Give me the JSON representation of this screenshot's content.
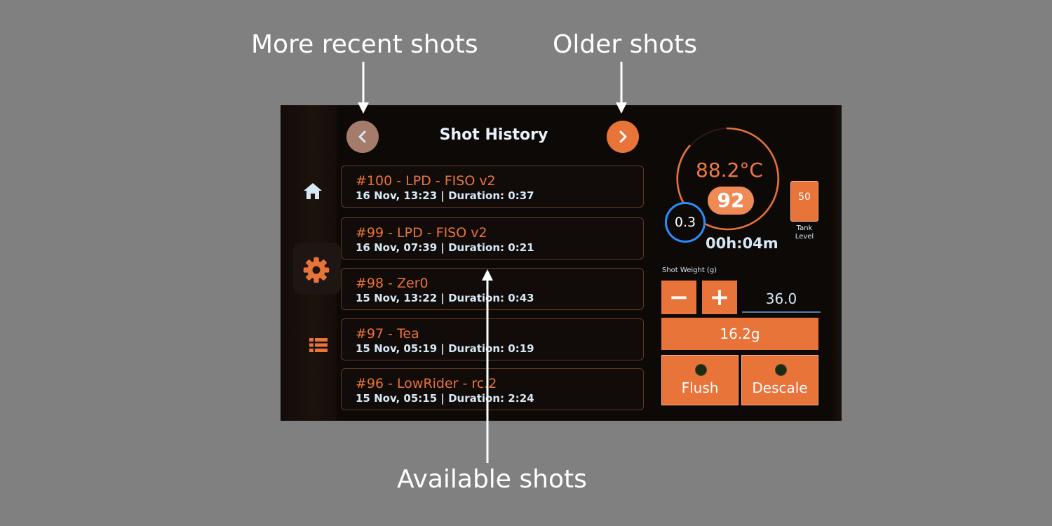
{
  "annotations": {
    "more_recent": "More recent shots",
    "older": "Older shots",
    "available": "Available shots"
  },
  "header": {
    "title": "Shot History"
  },
  "icons": {
    "prev": "chevron-left-icon",
    "next": "chevron-right-icon",
    "home": "home-icon",
    "settings": "gear-icon",
    "list": "list-icon"
  },
  "shots": [
    {
      "title": "#100 - LPD - FISO v2",
      "meta": "16 Nov, 13:23 | Duration: 0:37"
    },
    {
      "title": "#99 - LPD - FISO v2",
      "meta": "16 Nov, 07:39 | Duration: 0:21"
    },
    {
      "title": "#98 - Zer0",
      "meta": "15 Nov, 13:22 | Duration: 0:43"
    },
    {
      "title": "#97 - Tea",
      "meta": "15 Nov, 05:19 | Duration: 0:19"
    },
    {
      "title": "#96 - LowRider - rc.2",
      "meta": "15 Nov, 05:15 | Duration: 2:24"
    }
  ],
  "status": {
    "temperature": "88.2°C",
    "target_temperature": "92",
    "pressure": "0.3",
    "timer": "00h:04m",
    "tank_value": "50",
    "tank_label_line1": "Tank",
    "tank_label_line2": "Level"
  },
  "controls": {
    "shot_weight_label": "Shot Weight (g)",
    "minus_label": "−",
    "plus_label": "+",
    "shot_weight_value": "36.0",
    "current_weight": "16.2g",
    "flush_label": "Flush",
    "descale_label": "Descale"
  },
  "colors": {
    "accent": "#e8743a",
    "text_light": "#d6e7f5",
    "pressure_ring": "#2a8cff",
    "background": "#808080",
    "screen_bg": "#0d0907"
  }
}
